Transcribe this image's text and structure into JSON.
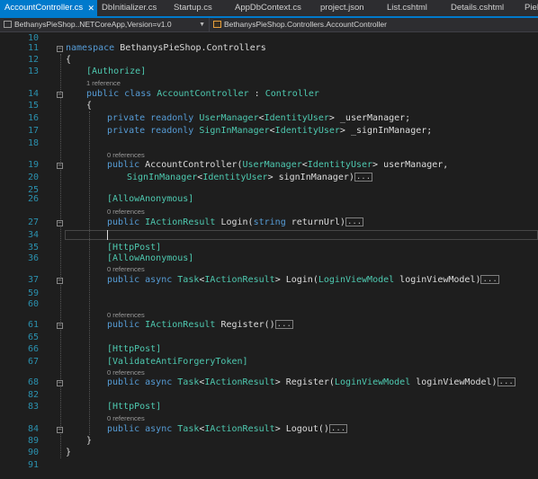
{
  "tabs": [
    {
      "label": "AccountController.cs",
      "active": true,
      "close": "✕"
    },
    {
      "label": "DbInitializer.cs"
    },
    {
      "label": "Startup.cs"
    },
    {
      "label": "AppDbContext.cs"
    },
    {
      "label": "project.json"
    },
    {
      "label": "List.cshtml"
    },
    {
      "label": "Details.cshtml"
    },
    {
      "label": "PieD"
    }
  ],
  "navbar": {
    "project": "BethanysPieShop..NETCoreApp,Version=v1.0",
    "scope": "BethanysPieShop.Controllers.AccountController",
    "dropdown": "▼"
  },
  "editor": {
    "line_numbers": [
      "10",
      "11",
      "12",
      "13",
      "14",
      "15",
      "16",
      "17",
      "18",
      "19",
      "20",
      "25",
      "26",
      "27",
      "34",
      "35",
      "36",
      "37",
      "59",
      "60",
      "61",
      "65",
      "66",
      "67",
      "68",
      "82",
      "83",
      "84",
      "89",
      "90",
      "91"
    ],
    "refs": {
      "class": "1 reference",
      "ctor": "0 references",
      "login_get": "0 references",
      "login_post": "0 references",
      "register_get": "0 references",
      "register_post": "0 references",
      "logout": "0 references"
    },
    "ellipsis": "...",
    "code": {
      "ns_kw": "namespace",
      "ns_name": " BethanysPieShop.Controllers",
      "brace_open": "{",
      "brace_close": "}",
      "authorize": "[Authorize]",
      "class_mod": "public class",
      "class_name": "AccountController",
      "class_colon": " : ",
      "class_base": "Controller",
      "f1_mod": "private readonly",
      "f1_type": "UserManager",
      "f1_lt": "<",
      "f1_arg": "IdentityUser",
      "f1_rest": "> _userManager;",
      "f2_mod": "private readonly",
      "f2_type": "SignInManager",
      "f2_lt": "<",
      "f2_arg": "IdentityUser",
      "f2_rest": "> _signInManager;",
      "ctor_mod": "public",
      "ctor_name": " AccountController(",
      "ctor_p1type": "UserManager",
      "ctor_p1lt": "<",
      "ctor_p1arg": "IdentityUser",
      "ctor_p1rest": "> userManager,",
      "ctor_p2type": "SignInManager",
      "ctor_p2lt": "<",
      "ctor_p2arg": "IdentityUser",
      "ctor_p2rest": "> signInManager)",
      "allow_anon": "[AllowAnonymous]",
      "login_mod": "public",
      "login_type": "IActionResult",
      "login_sig": " Login(",
      "login_ptype": "string",
      "login_prest": " returnUrl)",
      "httppost": "[HttpPost]",
      "allow_anon2": "[AllowAnonymous]",
      "loginp_mod": "public async",
      "loginp_task": "Task",
      "loginp_lt": "<",
      "loginp_type": "IActionResult",
      "loginp_sig": "> Login(",
      "loginp_ptype": "LoginViewModel",
      "loginp_prest": " loginViewModel)",
      "reg_mod": "public",
      "reg_type": "IActionResult",
      "reg_sig": " Register()",
      "httppost2": "[HttpPost]",
      "validate": "[ValidateAntiForgeryToken]",
      "regp_mod": "public async",
      "regp_task": "Task",
      "regp_lt": "<",
      "regp_type": "IActionResult",
      "regp_sig": "> Register(",
      "regp_ptype": "LoginViewModel",
      "regp_prest": " loginViewModel)",
      "httppost3": "[HttpPost]",
      "logout_mod": "public async",
      "logout_task": "Task",
      "logout_lt": "<",
      "logout_type": "IActionResult",
      "logout_sig": "> Logout()",
      "close_class": "}",
      "close_ns": "}"
    }
  }
}
